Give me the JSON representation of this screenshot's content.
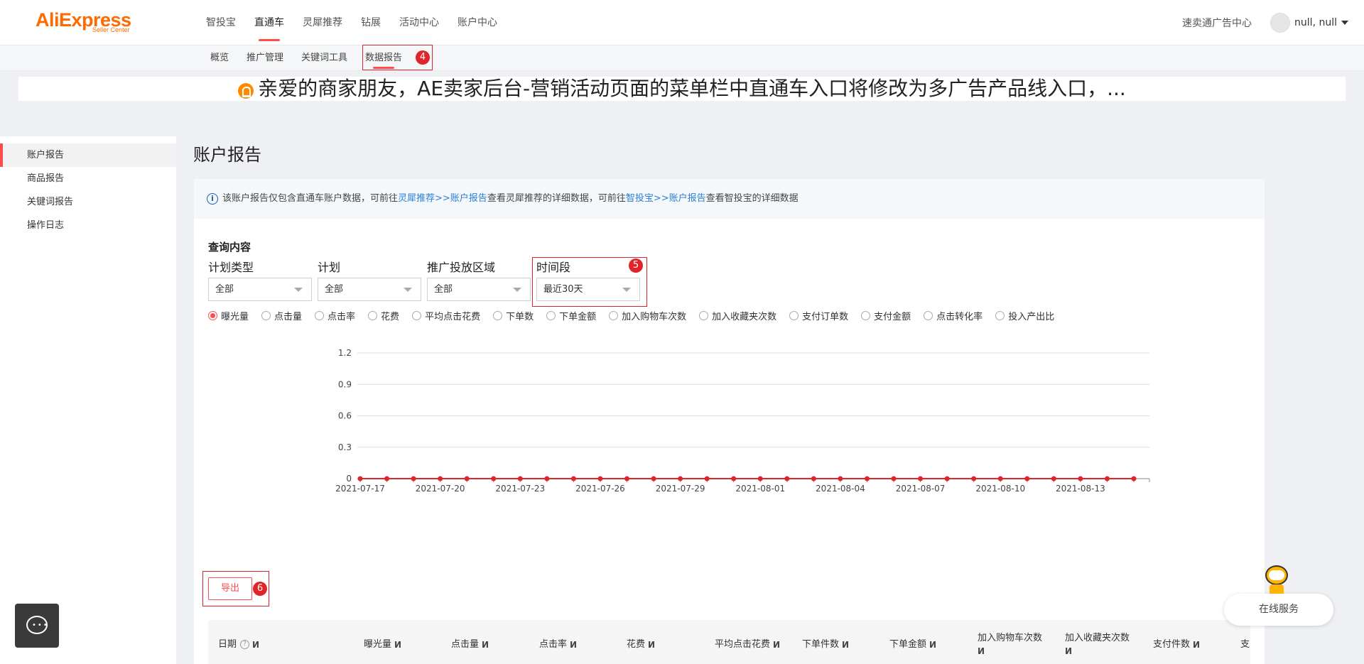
{
  "brand": {
    "name": "AliExpress",
    "sub": "Seller Center"
  },
  "topnav": {
    "items": [
      "智投宝",
      "直通车",
      "灵犀推荐",
      "钻展",
      "活动中心",
      "账户中心"
    ],
    "active_index": 1,
    "ad_center": "速卖通广告中心",
    "user": "null, null"
  },
  "subnav": {
    "items": [
      "概览",
      "推广管理",
      "关键词工具",
      "数据报告"
    ],
    "active_index": 3
  },
  "annotations": {
    "a4": "4",
    "a5": "5",
    "a6": "6"
  },
  "banner": {
    "text": "亲爱的商家朋友，AE卖家后台-营销活动页面的菜单栏中直通车入口将修改为多广告产品线入口，..."
  },
  "sidebar": {
    "items": [
      "账户报告",
      "商品报告",
      "关键词报告",
      "操作日志"
    ],
    "active_index": 0
  },
  "page": {
    "title": "账户报告"
  },
  "notice": {
    "t1": "该账户报告仅包含直通车账户数据，可前往",
    "link1": "灵犀推荐>>账户报告",
    "t2": "查看灵犀推荐的详细数据，可前往",
    "link2": "智投宝>>账户报告",
    "t3": "查看智投宝的详细数据"
  },
  "query": {
    "title": "查询内容",
    "filters": [
      {
        "label": "计划类型",
        "value": "全部"
      },
      {
        "label": "计划",
        "value": "全部"
      },
      {
        "label": "推广投放区域",
        "value": "全部"
      },
      {
        "label": "时间段",
        "value": "最近30天"
      }
    ]
  },
  "metrics": {
    "options": [
      "曝光量",
      "点击量",
      "点击率",
      "花费",
      "平均点击花费",
      "下单数",
      "下单金额",
      "加入购物车次数",
      "加入收藏夹次数",
      "支付订单数",
      "支付金额",
      "点击转化率",
      "投入产出比"
    ],
    "selected_index": 0
  },
  "chart_data": {
    "type": "line",
    "x": [
      "2021-07-17",
      "2021-07-18",
      "2021-07-19",
      "2021-07-20",
      "2021-07-21",
      "2021-07-22",
      "2021-07-23",
      "2021-07-24",
      "2021-07-25",
      "2021-07-26",
      "2021-07-27",
      "2021-07-28",
      "2021-07-29",
      "2021-07-30",
      "2021-07-31",
      "2021-08-01",
      "2021-08-02",
      "2021-08-03",
      "2021-08-04",
      "2021-08-05",
      "2021-08-06",
      "2021-08-07",
      "2021-08-08",
      "2021-08-09",
      "2021-08-10",
      "2021-08-11",
      "2021-08-12",
      "2021-08-13",
      "2021-08-14",
      "2021-08-15"
    ],
    "series": [
      {
        "values": [
          0,
          0,
          0,
          0,
          0,
          0,
          0,
          0,
          0,
          0,
          0,
          0,
          0,
          0,
          0,
          0,
          0,
          0,
          0,
          0,
          0,
          0,
          0,
          0,
          0,
          0,
          0,
          0,
          0,
          0
        ]
      }
    ],
    "y_ticks": [
      "0",
      "0.3",
      "0.6",
      "0.9",
      "1.2"
    ],
    "ylim": [
      0,
      1.2
    ],
    "x_tick_labels": [
      "2021-07-17",
      "2021-07-20",
      "2021-07-23",
      "2021-07-26",
      "2021-07-29",
      "2021-08-01",
      "2021-08-04",
      "2021-08-07",
      "2021-08-10",
      "2021-08-13"
    ],
    "color": "#e0252a",
    "grid": true
  },
  "export_label": "导出",
  "table": {
    "date_header": "日期",
    "headers": [
      "曝光量",
      "点击量",
      "点击率",
      "花费",
      "平均点击花费",
      "下单件数",
      "下单金额",
      "加入购物车次数",
      "加入收藏夹次数",
      "支付件数",
      "支"
    ]
  },
  "online_service": "在线服务"
}
